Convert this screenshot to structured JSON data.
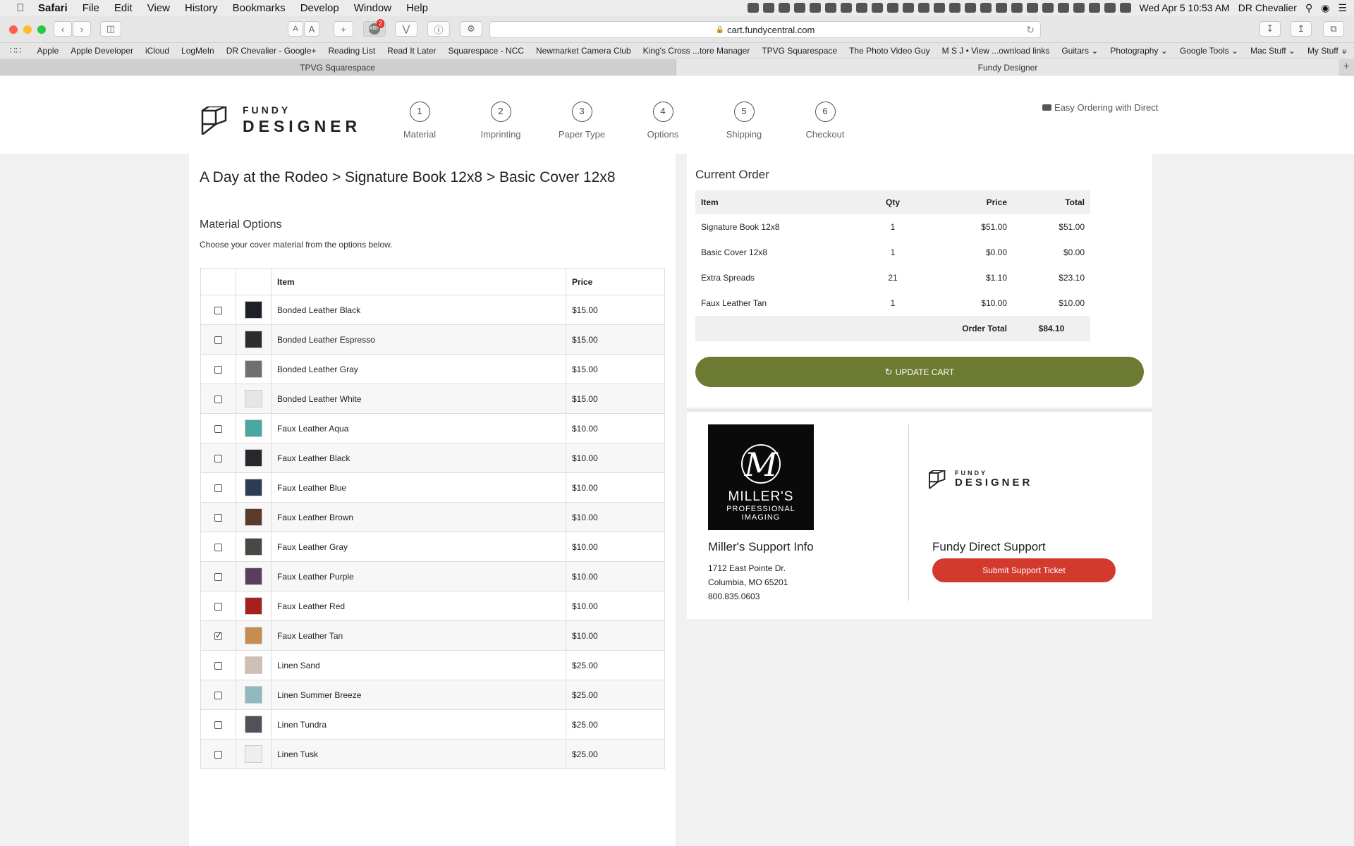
{
  "os_menubar": {
    "app": "Safari",
    "menus": [
      "File",
      "Edit",
      "View",
      "History",
      "Bookmarks",
      "Develop",
      "Window",
      "Help"
    ],
    "clock": "Wed Apr 5  10:53 AM",
    "user": "DR Chevalier"
  },
  "browser": {
    "url": "cart.fundycentral.com",
    "adblock_badge": "2",
    "bookmarks": [
      "Apple",
      "Apple Developer",
      "iCloud",
      "LogMeIn",
      "DR Chevalier - Google+",
      "Reading List",
      "Read It Later",
      "Squarespace - NCC",
      "Newmarket Camera Club",
      "King's Cross ...tore Manager",
      "TPVG Squarespace",
      "The Photo Video Guy",
      "M S J • View ...ownload links",
      "Guitars ⌄",
      "Photography ⌄",
      "Google Tools ⌄",
      "Mac Stuff ⌄",
      "My Stuff ⌄"
    ],
    "tabs": [
      {
        "label": "TPVG Squarespace"
      },
      {
        "label": "Fundy Designer"
      }
    ]
  },
  "header": {
    "logo_top": "FUNDY",
    "logo_bottom": "DESIGNER",
    "steps": [
      {
        "num": "1",
        "label": "Material"
      },
      {
        "num": "2",
        "label": "Imprinting"
      },
      {
        "num": "3",
        "label": "Paper Type"
      },
      {
        "num": "4",
        "label": "Options"
      },
      {
        "num": "5",
        "label": "Shipping"
      },
      {
        "num": "6",
        "label": "Checkout"
      }
    ],
    "easy_ordering": "Easy Ordering with Direct"
  },
  "main": {
    "breadcrumb": "A Day at the Rodeo > Signature Book 12x8 > Basic Cover 12x8",
    "section_title": "Material Options",
    "section_subtitle": "Choose your cover material from the options below.",
    "columns": {
      "item": "Item",
      "price": "Price"
    },
    "materials": [
      {
        "name": "Bonded Leather Black",
        "price": "$15.00",
        "color": "#1e2228",
        "checked": false
      },
      {
        "name": "Bonded Leather Espresso",
        "price": "$15.00",
        "color": "#2f2a30",
        "checked": false
      },
      {
        "name": "Bonded Leather Gray",
        "price": "$15.00",
        "color": "#707072",
        "checked": false
      },
      {
        "name": "Bonded Leather White",
        "price": "$15.00",
        "color": "#e6e6e6",
        "checked": false
      },
      {
        "name": "Faux Leather Aqua",
        "price": "$10.00",
        "color": "#4aa7a0",
        "checked": false
      },
      {
        "name": "Faux Leather Black",
        "price": "$10.00",
        "color": "#26282c",
        "checked": false
      },
      {
        "name": "Faux Leather Blue",
        "price": "$10.00",
        "color": "#2e3b55",
        "checked": false
      },
      {
        "name": "Faux Leather Brown",
        "price": "$10.00",
        "color": "#5a3a2a",
        "checked": false
      },
      {
        "name": "Faux Leather Gray",
        "price": "$10.00",
        "color": "#4a4844",
        "checked": false
      },
      {
        "name": "Faux Leather Purple",
        "price": "$10.00",
        "color": "#5c3d62",
        "checked": false
      },
      {
        "name": "Faux Leather Red",
        "price": "$10.00",
        "color": "#a42022",
        "checked": false
      },
      {
        "name": "Faux Leather Tan",
        "price": "$10.00",
        "color": "#c58d4e",
        "checked": true
      },
      {
        "name": "Linen Sand",
        "price": "$25.00",
        "color": "#cdbfb4",
        "checked": false
      },
      {
        "name": "Linen Summer Breeze",
        "price": "$25.00",
        "color": "#8fb9bd",
        "checked": false
      },
      {
        "name": "Linen Tundra",
        "price": "$25.00",
        "color": "#515259",
        "checked": false
      },
      {
        "name": "Linen Tusk",
        "price": "$25.00",
        "color": "#eeeeee",
        "checked": false
      }
    ]
  },
  "order": {
    "title": "Current Order",
    "columns": {
      "item": "Item",
      "qty": "Qty",
      "price": "Price",
      "total": "Total"
    },
    "rows": [
      {
        "item": "Signature Book 12x8",
        "qty": "1",
        "price": "$51.00",
        "total": "$51.00"
      },
      {
        "item": "Basic Cover 12x8",
        "qty": "1",
        "price": "$0.00",
        "total": "$0.00"
      },
      {
        "item": "Extra Spreads",
        "qty": "21",
        "price": "$1.10",
        "total": "$23.10"
      },
      {
        "item": "Faux Leather Tan",
        "qty": "1",
        "price": "$10.00",
        "total": "$10.00"
      }
    ],
    "total_label": "Order Total",
    "total_value": "$84.10",
    "update_button": "UPDATE CART",
    "accent_color": "#6c7a32"
  },
  "support": {
    "lab_logo_letter": "M",
    "lab_logo_name": "MILLER'S",
    "lab_logo_tagline": "PROFESSIONAL IMAGING",
    "lab_title": "Miller's Support Info",
    "lab_address_1": "1712 East Pointe Dr.",
    "lab_address_2": "Columbia, MO 65201",
    "lab_phone": "800.835.0603",
    "fundy_logo_top": "FUNDY",
    "fundy_logo_bottom": "DESIGNER",
    "fundy_title": "Fundy Direct Support",
    "ticket_button": "Submit Support Ticket",
    "ticket_color": "#d23a2e"
  }
}
